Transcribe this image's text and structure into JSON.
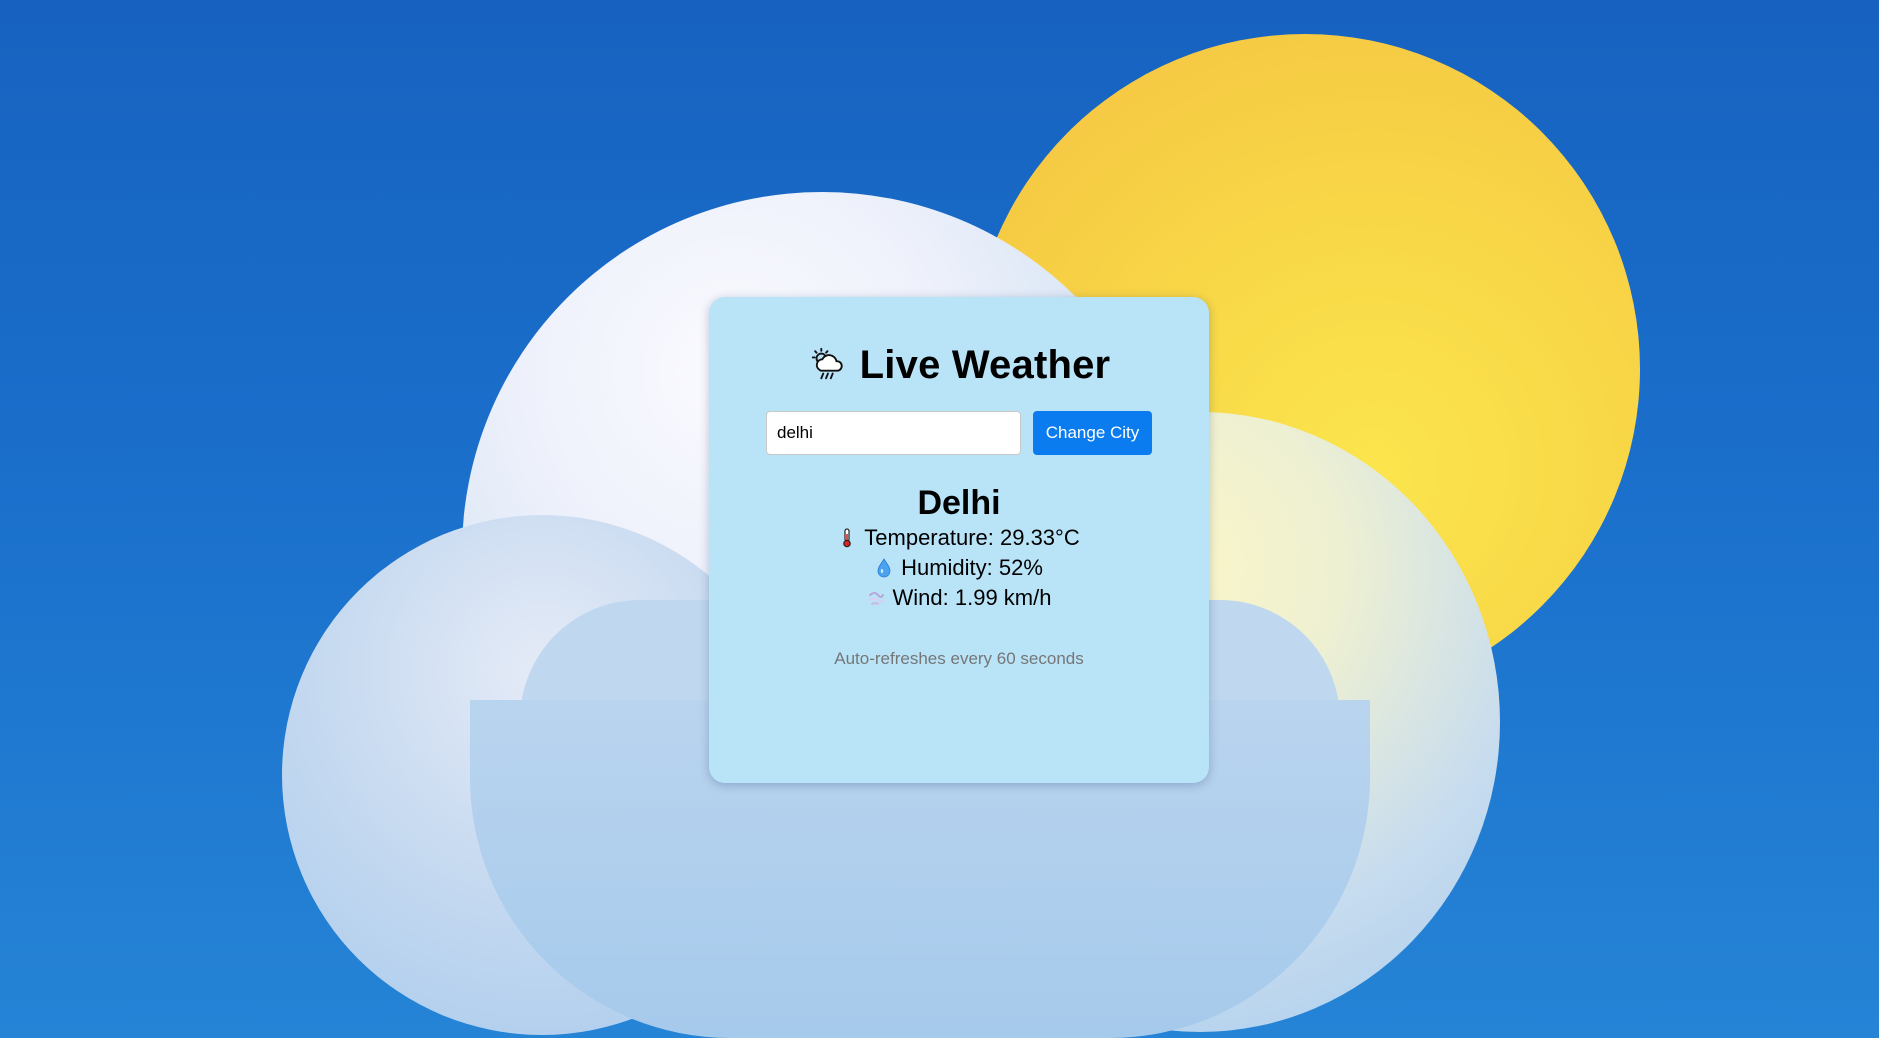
{
  "app": {
    "title": "Live Weather",
    "title_icon": "cloud-sun-rain-icon"
  },
  "search": {
    "value": "delhi",
    "button_label": "Change City"
  },
  "weather": {
    "city": "Delhi",
    "temperature": {
      "icon": "thermometer-icon",
      "text": "Temperature: 29.33°C"
    },
    "humidity": {
      "icon": "droplet-icon",
      "text": "Humidity: 52%"
    },
    "wind": {
      "icon": "wind-icon",
      "text": "Wind: 1.99 km/h"
    }
  },
  "footer": {
    "refresh_note": "Auto-refreshes every 60 seconds"
  },
  "colors": {
    "card_background": "#b9e4f8",
    "button_background": "#0b7bf0",
    "sky": "#1a6fcb",
    "sun": "#f8d646"
  }
}
